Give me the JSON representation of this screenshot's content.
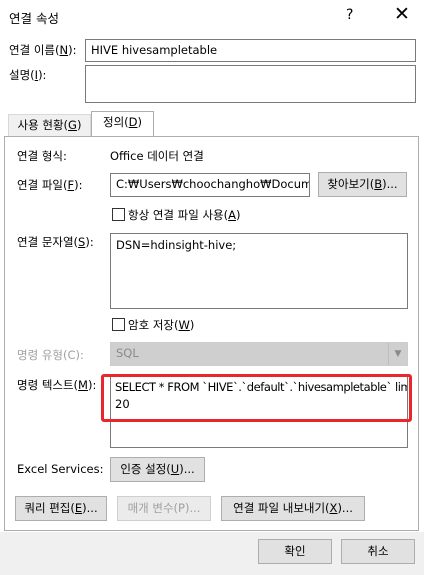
{
  "window": {
    "title": "연결 속성",
    "help_glyph": "?",
    "close_glyph": "✕"
  },
  "connection_name": {
    "label_pre": "연결 이름(",
    "label_key": "N",
    "label_post": "):",
    "value": "HIVE hivesampletable"
  },
  "description": {
    "label_pre": "설명(",
    "label_key": "I",
    "label_post": "):",
    "value": ""
  },
  "tabs": [
    {
      "pre": "사용 현황(",
      "key": "G",
      "post": ")"
    },
    {
      "pre": "정의(",
      "key": "D",
      "post": ")"
    }
  ],
  "definition": {
    "connection_type_label": "연결 형식:",
    "connection_type_value": "Office 데이터 연결",
    "connection_file": {
      "label_pre": "연결 파일(",
      "label_key": "F",
      "label_post": "):",
      "value": "C:₩Users₩choochangho₩Documen",
      "browse_pre": "찾아보기(",
      "browse_key": "B",
      "browse_post": ")..."
    },
    "always_use_file": {
      "pre": "항상 연결 파일 사용(",
      "key": "A",
      "post": ")",
      "checked": false
    },
    "connection_string": {
      "label_pre": "연결 문자열(",
      "label_key": "S",
      "label_post": "):",
      "value": "DSN=hdinsight-hive;"
    },
    "save_password": {
      "pre": "암호 저장(",
      "key": "W",
      "post": ")",
      "checked": false
    },
    "command_type": {
      "label": "명령 유형(C):",
      "value": "SQL",
      "disabled": true
    },
    "command_text": {
      "label_pre": "명령 텍스트(",
      "label_key": "M",
      "label_post": "):",
      "line1": "SELECT * FROM `HIVE`.`default`.`hivesampletable` limit",
      "line2": "20"
    },
    "excel_services": {
      "label": "Excel Services:",
      "auth_pre": "인증 설정(",
      "auth_key": "U",
      "auth_post": ")..."
    },
    "edit_query": {
      "pre": "쿼리 편집(",
      "key": "E",
      "post": ")..."
    },
    "parameters": {
      "label": "매개 변수(P)...",
      "disabled": true
    },
    "export": {
      "pre": "연결 파일 내보내기(",
      "key": "X",
      "post": ")..."
    }
  },
  "footer": {
    "ok": "확인",
    "cancel": "취소"
  }
}
